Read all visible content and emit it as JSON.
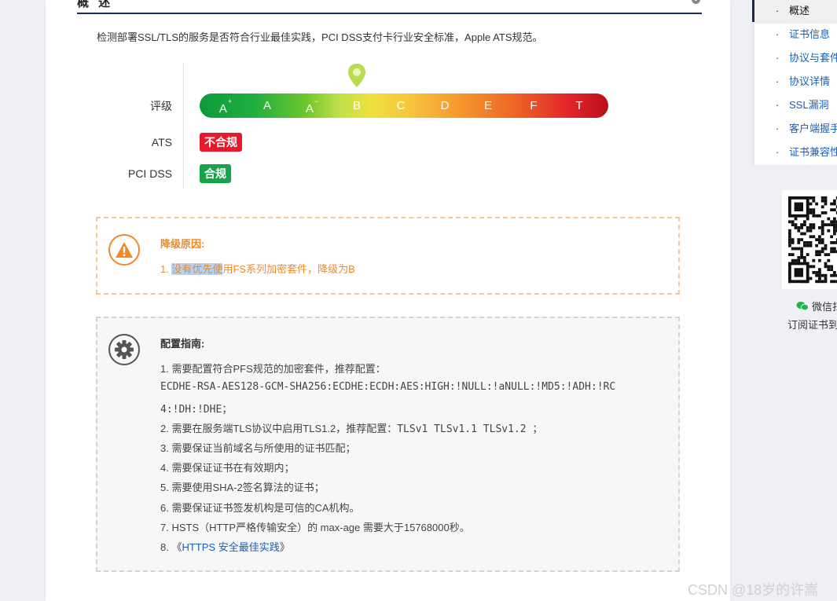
{
  "section": {
    "title": "概 述",
    "info_icon": "info-icon",
    "description": "检测部署SSL/TLS的服务是否符合行业最佳实践，PCI DSS支付卡行业安全标准，Apple ATS规范。"
  },
  "rating": {
    "label": "评级",
    "current_grade": "B",
    "grades": [
      {
        "base": "A",
        "sup": "+"
      },
      {
        "base": "A",
        "sup": ""
      },
      {
        "base": "A",
        "sup": "−"
      },
      {
        "base": "B",
        "sup": ""
      },
      {
        "base": "C",
        "sup": ""
      },
      {
        "base": "D",
        "sup": ""
      },
      {
        "base": "E",
        "sup": ""
      },
      {
        "base": "F",
        "sup": ""
      },
      {
        "base": "T",
        "sup": ""
      }
    ]
  },
  "ats": {
    "label": "ATS",
    "status": "不合规",
    "color": "#e8192c"
  },
  "pci": {
    "label": "PCI DSS",
    "status": "合规",
    "color": "#17a34a"
  },
  "downgrade": {
    "title": "降级原因:",
    "prefix": "1. ",
    "selected_text": "没有优先使",
    "rest_text": "用FS系列加密套件，降级为B",
    "color": "#ef8a2b"
  },
  "guide": {
    "title": "配置指南:",
    "lines": [
      "1. 需要配置符合PFS规范的加密套件，推荐配置：",
      "ECDHE-RSA-AES128-GCM-SHA256:ECDHE:ECDH:AES:HIGH:!NULL:!aNULL:!MD5:!ADH:!RC",
      "4:!DH:!DHE；",
      "2. 需要在服务端TLS协议中启用TLS1.2，推荐配置：",
      "TLSv1 TLSv1.1 TLSv1.2 ；",
      "3. 需要保证当前域名与所使用的证书匹配；",
      "4. 需要保证证书在有效期内；",
      "5. 需要使用SHA-2签名算法的证书；",
      "6. 需要保证证书签发机构是可信的CA机构。",
      "7. HSTS（HTTP严格传输安全）的 max-age 需要大于15768000秒。"
    ],
    "line8_prefix": "8. 《",
    "line8_link": "HTTPS 安全最佳实践",
    "line8_suffix": "》"
  },
  "toc": {
    "items": [
      "概述",
      "证书信息",
      "协议与套件",
      "协议详情",
      "SSL漏洞",
      "客户端握手",
      "证书兼容性"
    ],
    "active_index": 0
  },
  "qr": {
    "wechat_label": "微信扫",
    "subscribe_label": "订阅证书到"
  },
  "watermark": "CSDN @18岁的许嵩"
}
